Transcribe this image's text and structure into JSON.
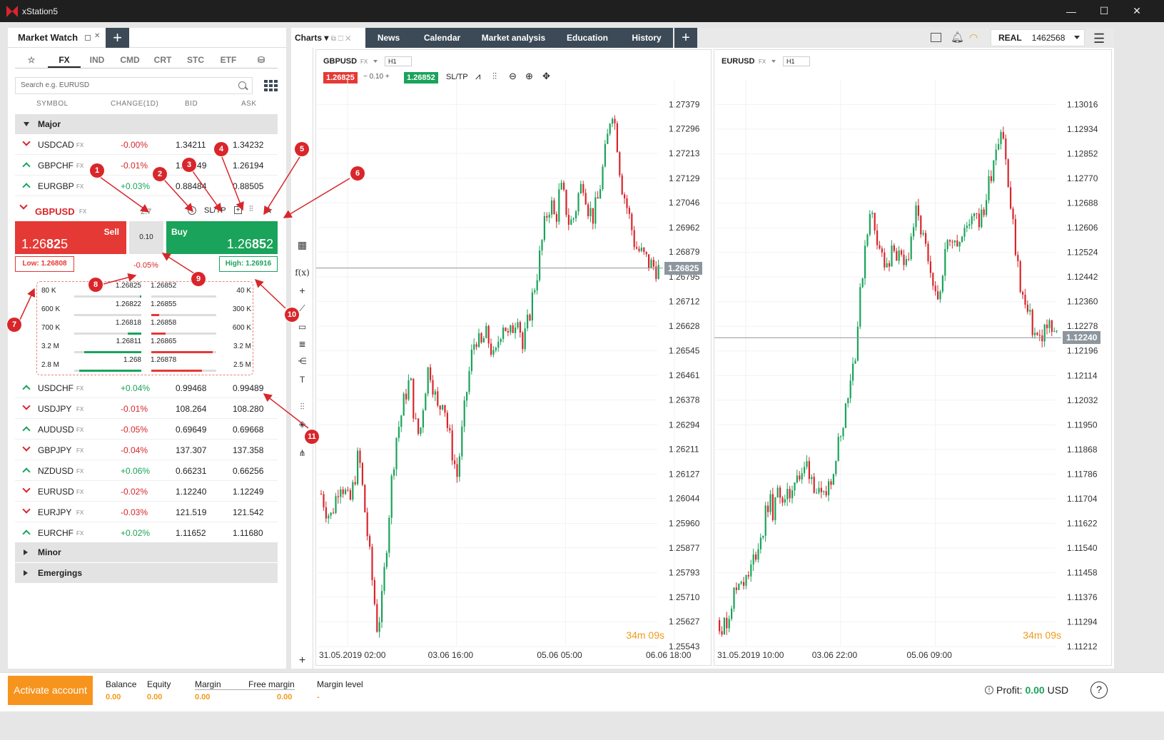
{
  "window": {
    "title": "xStation5",
    "min": "—",
    "max": "☐",
    "close": "✕"
  },
  "market_watch": {
    "title": "Market Watch",
    "plus": "+",
    "categories": [
      "☆",
      "FX",
      "IND",
      "CMD",
      "CRT",
      "STC",
      "ETF",
      "⛁"
    ],
    "search_placeholder": "Search e.g. EURUSD",
    "columns": [
      "SYMBOL",
      "CHANGE(1D)",
      "BID",
      "ASK"
    ],
    "groups": {
      "major": "Major",
      "minor": "Minor",
      "emergings": "Emergings"
    },
    "rows_top": [
      {
        "dir": "dn",
        "symbol": "USDCAD",
        "tag": "FX",
        "change": "-0.00%",
        "bid": "1.34211",
        "ask": "1.34232"
      },
      {
        "dir": "up",
        "symbol": "GBPCHF",
        "tag": "FX",
        "change": "-0.01%",
        "bid": "1.26149",
        "ask": "1.26194"
      },
      {
        "dir": "up",
        "symbol": "EURGBP",
        "tag": "FX",
        "change": "+0.03%",
        "bid": "0.88484",
        "ask": "0.88505"
      }
    ],
    "expanded": {
      "symbol": "GBPUSD",
      "tag": "FX",
      "spread": "2.7",
      "sltp": "SL/TP",
      "sell_label": "Sell",
      "sell_price_a": "1.26",
      "sell_price_b": "82",
      "sell_price_c": "5",
      "buy_label": "Buy",
      "buy_price_a": "1.26",
      "buy_price_b": "85",
      "buy_price_c": "2",
      "volume": "0.10",
      "low": "Low: 1.26808",
      "high": "High: 1.26916",
      "change": "-0.05%",
      "depth": [
        {
          "bidvol": "80 K",
          "bid": "1.26825",
          "ask": "1.26852",
          "askvol": "40 K",
          "bidfill": 0.02,
          "askfill": 0.0
        },
        {
          "bidvol": "600 K",
          "bid": "1.26822",
          "ask": "1.26855",
          "askvol": "300 K",
          "bidfill": 0.0,
          "askfill": 0.12
        },
        {
          "bidvol": "700 K",
          "bid": "1.26818",
          "ask": "1.26858",
          "askvol": "600 K",
          "bidfill": 0.2,
          "askfill": 0.22
        },
        {
          "bidvol": "3.2 M",
          "bid": "1.26811",
          "ask": "1.26865",
          "askvol": "3.2 M",
          "bidfill": 0.85,
          "askfill": 0.95
        },
        {
          "bidvol": "2.8 M",
          "bid": "1.268",
          "ask": "1.26878",
          "askvol": "2.5 M",
          "bidfill": 0.93,
          "askfill": 0.78
        }
      ]
    },
    "rows_bottom": [
      {
        "dir": "up",
        "symbol": "USDCHF",
        "tag": "FX",
        "change": "+0.04%",
        "bid": "0.99468",
        "ask": "0.99489"
      },
      {
        "dir": "dn",
        "symbol": "USDJPY",
        "tag": "FX",
        "change": "-0.01%",
        "bid": "108.264",
        "ask": "108.280"
      },
      {
        "dir": "up",
        "symbol": "AUDUSD",
        "tag": "FX",
        "change": "-0.05%",
        "bid": "0.69649",
        "ask": "0.69668"
      },
      {
        "dir": "dn",
        "symbol": "GBPJPY",
        "tag": "FX",
        "change": "-0.04%",
        "bid": "137.307",
        "ask": "137.358"
      },
      {
        "dir": "up",
        "symbol": "NZDUSD",
        "tag": "FX",
        "change": "+0.06%",
        "bid": "0.66231",
        "ask": "0.66256"
      },
      {
        "dir": "dn",
        "symbol": "EURUSD",
        "tag": "FX",
        "change": "-0.02%",
        "bid": "1.12240",
        "ask": "1.12249"
      },
      {
        "dir": "dn",
        "symbol": "EURJPY",
        "tag": "FX",
        "change": "-0.03%",
        "bid": "121.519",
        "ask": "121.542"
      },
      {
        "dir": "up",
        "symbol": "EURCHF",
        "tag": "FX",
        "change": "+0.02%",
        "bid": "1.11652",
        "ask": "1.11680"
      }
    ]
  },
  "callouts": [
    "1",
    "2",
    "3",
    "4",
    "5",
    "6",
    "7",
    "8",
    "9",
    "10",
    "11"
  ],
  "tabs": [
    "Charts",
    "News",
    "Calendar",
    "Market analysis",
    "Education",
    "History",
    "+"
  ],
  "account_badge": {
    "type": "REAL",
    "number": "1462568"
  },
  "chart_data": [
    {
      "type": "candlestick",
      "symbol": "GBPUSD",
      "tag": "FX",
      "timeframe": "H1",
      "sell": "1.26825",
      "volume": "0.10",
      "buy": "1.26852",
      "sltp": "SL/TP",
      "ylim": [
        1.25543,
        1.27462
      ],
      "y_ticks": [
        "1.27379",
        "1.27296",
        "1.27213",
        "1.27129",
        "1.27046",
        "1.26962",
        "1.26879",
        "1.26795",
        "1.26712",
        "1.26628",
        "1.26545",
        "1.26461",
        "1.26378",
        "1.26294",
        "1.26211",
        "1.26127",
        "1.26044",
        "1.25960",
        "1.25877",
        "1.25793",
        "1.25710",
        "1.25627",
        "1.25543"
      ],
      "x_ticks": [
        "31.05.2019 02:00",
        "03.06 16:00",
        "05.06 05:00",
        "06.06 18:00"
      ],
      "last_price": "1.26825",
      "last_value": 1.26825,
      "timer": "34m 09s",
      "path": [
        1.2606,
        1.2601,
        1.2598,
        1.2604,
        1.2611,
        1.2607,
        1.2602,
        1.261,
        1.262,
        1.2605,
        1.259,
        1.2575,
        1.256,
        1.257,
        1.259,
        1.261,
        1.2625,
        1.2632,
        1.264,
        1.2645,
        1.263,
        1.2625,
        1.264,
        1.265,
        1.2642,
        1.2633,
        1.264,
        1.2628,
        1.262,
        1.2612,
        1.2626,
        1.264,
        1.2652,
        1.266,
        1.2655,
        1.266,
        1.2657,
        1.265,
        1.266,
        1.2665,
        1.2658,
        1.2663,
        1.2668,
        1.2655,
        1.2663,
        1.2672,
        1.268,
        1.269,
        1.27,
        1.2705,
        1.2698,
        1.271,
        1.2705,
        1.2697,
        1.27,
        1.2708,
        1.2712,
        1.2703,
        1.27,
        1.2705,
        1.2715,
        1.2725,
        1.2738,
        1.2728,
        1.2712,
        1.2705,
        1.2698,
        1.269,
        1.2688,
        1.2686,
        1.2684,
        1.2683,
        1.2682
      ]
    },
    {
      "type": "candlestick",
      "symbol": "EURUSD",
      "tag": "FX",
      "timeframe": "H1",
      "ylim": [
        1.11212,
        1.13098
      ],
      "y_ticks": [
        "1.13016",
        "1.12934",
        "1.12852",
        "1.12770",
        "1.12688",
        "1.12606",
        "1.12524",
        "1.12442",
        "1.12360",
        "1.12278",
        "1.12196",
        "1.12114",
        "1.12032",
        "1.11950",
        "1.11868",
        "1.11786",
        "1.11704",
        "1.11622",
        "1.11540",
        "1.11458",
        "1.11376",
        "1.11294",
        "1.11212"
      ],
      "x_ticks": [
        "31.05.2019 10:00",
        "03.06 22:00",
        "05.06 09:00"
      ],
      "last_price": "1.12240",
      "last_value": 1.1224,
      "timer": "34m 09s",
      "path": [
        1.113,
        1.1127,
        1.1135,
        1.114,
        1.1145,
        1.1142,
        1.1148,
        1.1155,
        1.116,
        1.117,
        1.1165,
        1.1175,
        1.1168,
        1.1172,
        1.118,
        1.1176,
        1.1182,
        1.1178,
        1.1172,
        1.1168,
        1.1175,
        1.1182,
        1.119,
        1.12,
        1.121,
        1.122,
        1.124,
        1.126,
        1.1265,
        1.1258,
        1.125,
        1.1245,
        1.1255,
        1.125,
        1.1246,
        1.1255,
        1.1265,
        1.126,
        1.1252,
        1.124,
        1.1235,
        1.1248,
        1.1255,
        1.126,
        1.1255,
        1.1258,
        1.1264,
        1.1268,
        1.1262,
        1.127,
        1.128,
        1.129,
        1.1295,
        1.1275,
        1.126,
        1.1245,
        1.1235,
        1.123,
        1.1225,
        1.1223,
        1.1228,
        1.1226,
        1.1224
      ]
    }
  ],
  "bottom": {
    "activate": "Activate account",
    "balance": "Balance",
    "balance_v": "0.00",
    "equity": "Equity",
    "equity_v": "0.00",
    "margin": "Margin",
    "margin_v": "0.00",
    "free_margin": "Free margin",
    "free_margin_v": "0.00",
    "margin_level": "Margin level",
    "margin_level_v": "-",
    "profit_label": "Profit:",
    "profit_v": "0.00",
    "profit_cur": "USD",
    "help": "?"
  }
}
